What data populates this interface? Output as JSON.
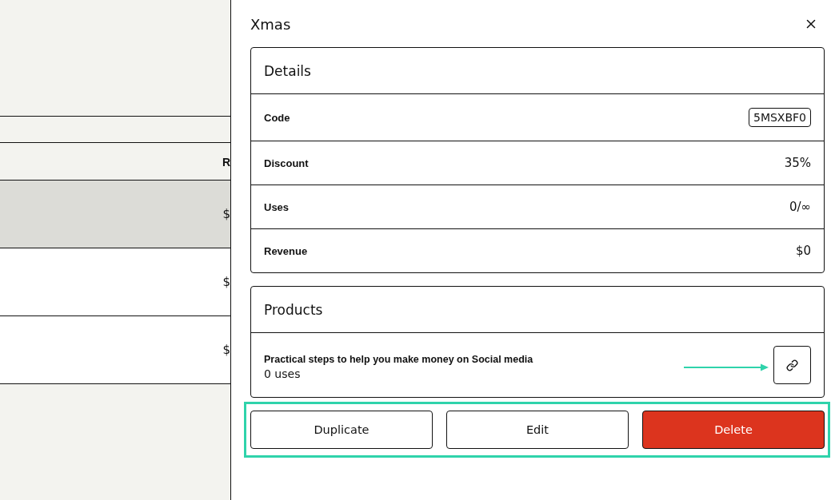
{
  "background_table": {
    "column_header": "R",
    "rows": [
      {
        "cell": "$",
        "selected": true
      },
      {
        "cell": "$",
        "selected": false
      },
      {
        "cell": "$",
        "selected": false
      }
    ]
  },
  "drawer": {
    "title": "Xmas",
    "details": {
      "title": "Details",
      "rows": [
        {
          "label": "Code",
          "value": "5MSXBF0",
          "kind": "code"
        },
        {
          "label": "Discount",
          "value": "35%",
          "kind": "text"
        },
        {
          "label": "Uses",
          "value": "0/∞",
          "kind": "text"
        },
        {
          "label": "Revenue",
          "value": "$0",
          "kind": "text"
        }
      ]
    },
    "products": {
      "title": "Products",
      "items": [
        {
          "name": "Practical steps to help you make money on Social media",
          "uses": "0 uses"
        }
      ]
    },
    "actions": [
      {
        "label": "Duplicate",
        "kind": "secondary"
      },
      {
        "label": "Edit",
        "kind": "secondary"
      },
      {
        "label": "Delete",
        "kind": "danger"
      }
    ]
  }
}
